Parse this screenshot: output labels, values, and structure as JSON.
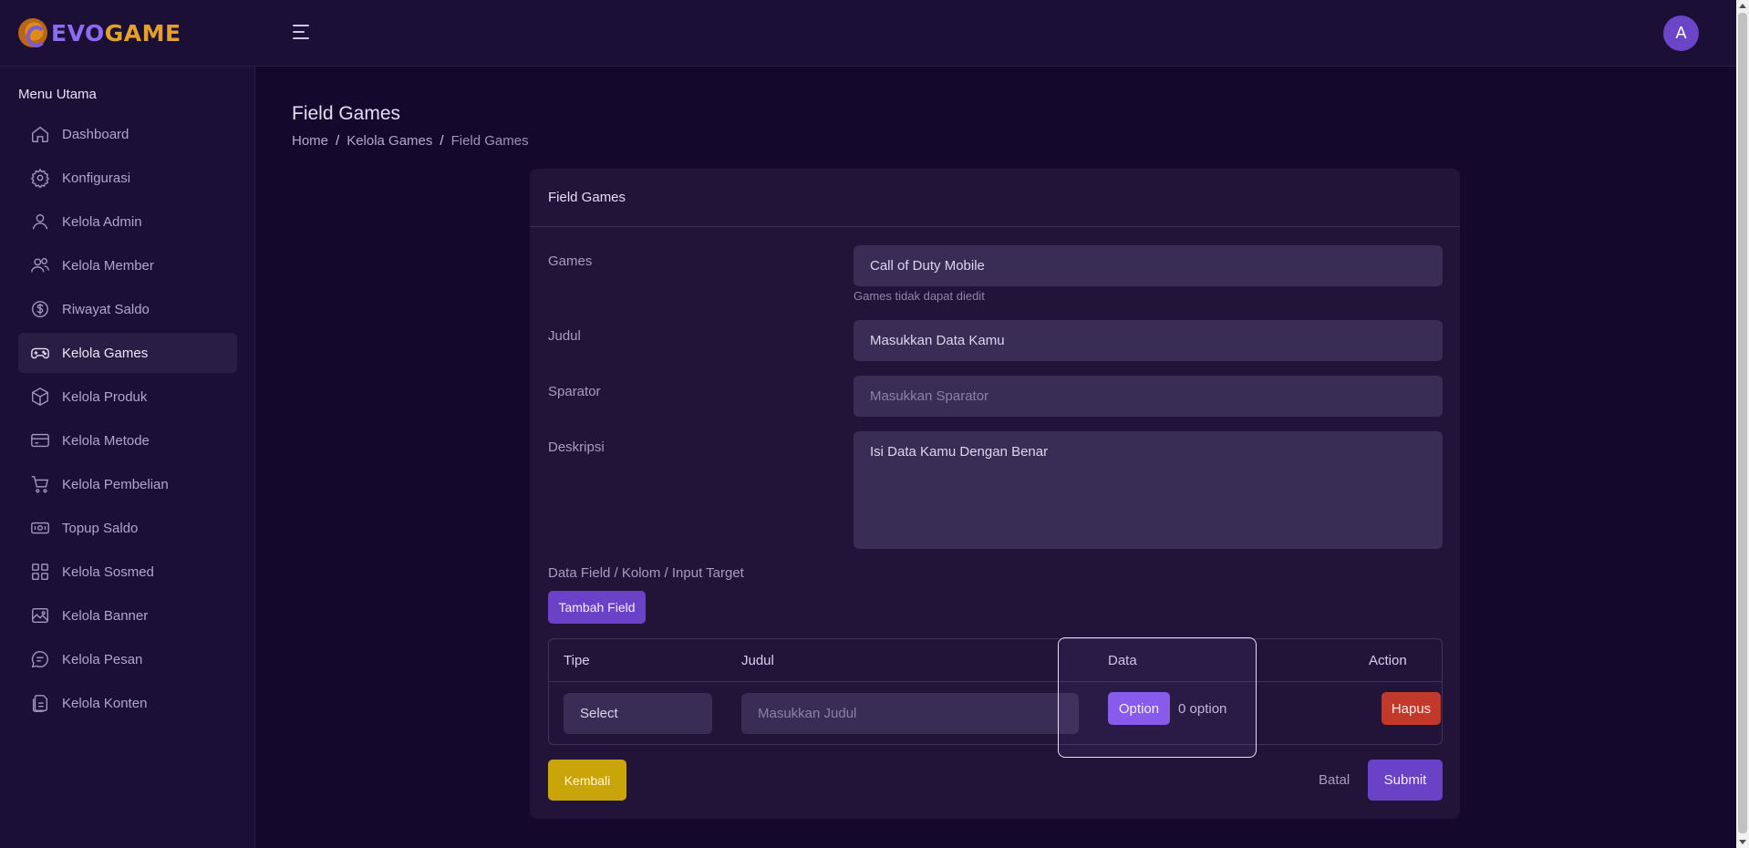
{
  "brand": {
    "evo": "EVO",
    "game": "GAME"
  },
  "header": {
    "avatar_initial": "A"
  },
  "sidebar": {
    "title": "Menu Utama",
    "items": [
      {
        "label": "Dashboard",
        "icon": "home-icon"
      },
      {
        "label": "Konfigurasi",
        "icon": "gear-icon"
      },
      {
        "label": "Kelola Admin",
        "icon": "user-icon"
      },
      {
        "label": "Kelola Member",
        "icon": "users-icon"
      },
      {
        "label": "Riwayat Saldo",
        "icon": "dollar-circle-icon"
      },
      {
        "label": "Kelola Games",
        "icon": "gamepad-icon",
        "active": true
      },
      {
        "label": "Kelola Produk",
        "icon": "box-icon"
      },
      {
        "label": "Kelola Metode",
        "icon": "card-icon"
      },
      {
        "label": "Kelola Pembelian",
        "icon": "cart-icon"
      },
      {
        "label": "Topup Saldo",
        "icon": "money-icon"
      },
      {
        "label": "Kelola Sosmed",
        "icon": "grid-icon"
      },
      {
        "label": "Kelola Banner",
        "icon": "image-icon"
      },
      {
        "label": "Kelola Pesan",
        "icon": "message-icon"
      },
      {
        "label": "Kelola Konten",
        "icon": "document-icon"
      }
    ]
  },
  "page": {
    "title": "Field Games",
    "breadcrumb": [
      "Home",
      "Kelola Games",
      "Field Games"
    ],
    "separator": "/"
  },
  "card": {
    "title": "Field Games",
    "fields": {
      "games": {
        "label": "Games",
        "value": "Call of Duty Mobile",
        "help": "Games tidak dapat diedit"
      },
      "judul": {
        "label": "Judul",
        "value": "Masukkan Data Kamu"
      },
      "sparator": {
        "label": "Sparator",
        "placeholder": "Masukkan Sparator"
      },
      "deskripsi": {
        "label": "Deskripsi",
        "value": "Isi Data Kamu Dengan Benar"
      }
    },
    "data_field_label": "Data Field / Kolom / Input Target",
    "add_button": "Tambah Field",
    "table": {
      "headers": [
        "Tipe",
        "Judul",
        "Data",
        "Action"
      ],
      "row": {
        "tipe": "Select",
        "judul_placeholder": "Masukkan Judul",
        "option_button": "Option",
        "option_count": "0 option",
        "delete_button": "Hapus"
      }
    },
    "back_button": "Kembali",
    "cancel_link": "Batal",
    "submit_button": "Submit"
  },
  "colors": {
    "accent": "#6a42c8",
    "danger": "#c0392b",
    "warning": "#c9a50a",
    "background": "#14082c"
  }
}
